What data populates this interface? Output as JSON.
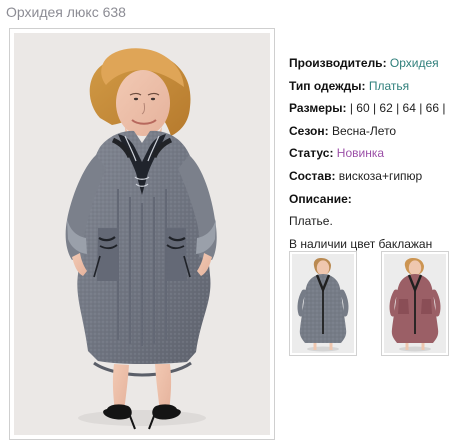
{
  "product": {
    "title": "Орхидея люкс 638"
  },
  "details": {
    "manufacturer_label": "Производитель:",
    "manufacturer_value": "Орхидея",
    "clothing_type_label": "Тип одежды:",
    "clothing_type_value": "Платья",
    "sizes_label": "Размеры:",
    "sizes_value": "| 60 | 62 | 64 | 66 |",
    "season_label": "Сезон:",
    "season_value": "Весна-Лето",
    "status_label": "Статус:",
    "status_value": "Новинка",
    "composition_label": "Состав:",
    "composition_value": "вискоза+гипюр",
    "description_label": "Описание:",
    "description_line_1": "Платье.",
    "description_line_2": "В наличии цвет баклажан"
  },
  "colors": {
    "title": "#8c8c94",
    "link": "#2f7f7b",
    "status": "#9b4fa7",
    "dress_gray": "#757a86",
    "dress_purple": "#9b5f66",
    "trim_black": "#202020"
  },
  "thumbnails": [
    {
      "icon": "dress-thumbnail-gray-icon"
    },
    {
      "icon": "dress-thumbnail-purple-icon"
    }
  ]
}
